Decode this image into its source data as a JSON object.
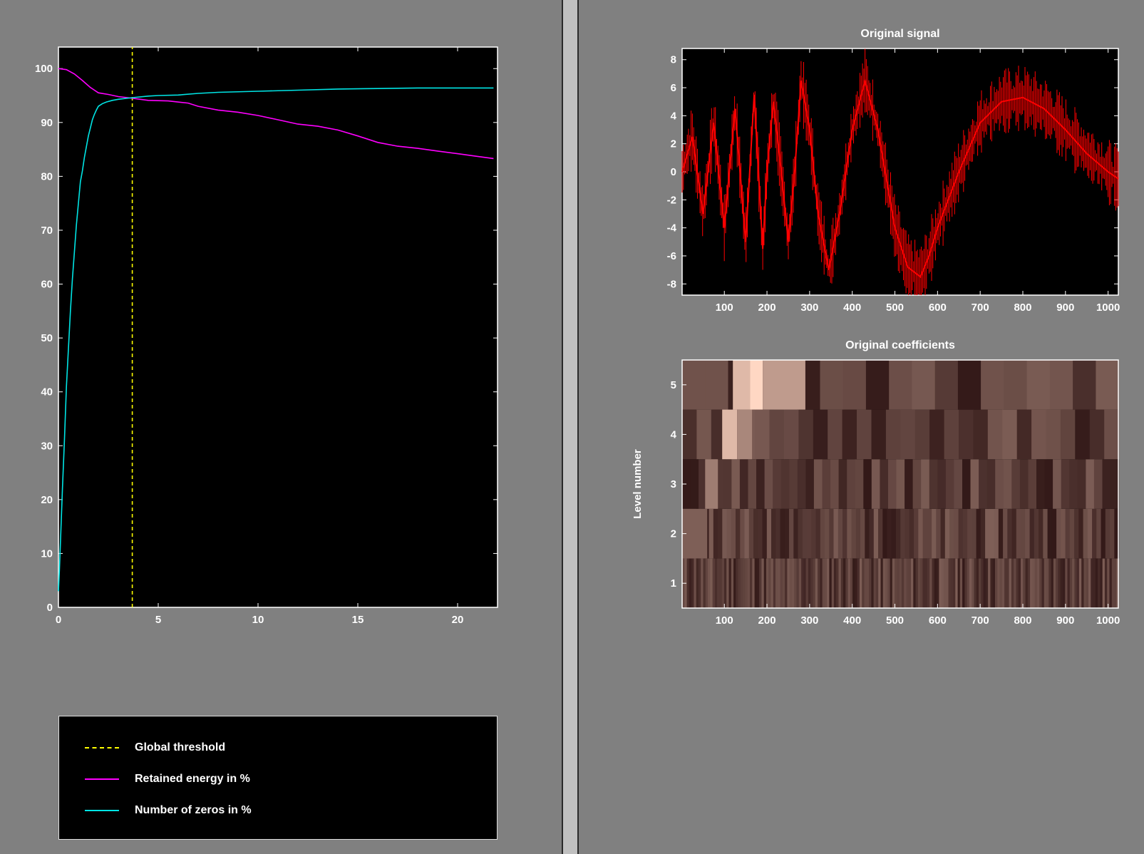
{
  "colors": {
    "background": "#808080",
    "axes_bg": "#000000",
    "threshold": "#ffff00",
    "retained_energy": "#ff00ff",
    "zeros": "#00e5e5",
    "signal": "#ff0000"
  },
  "chart_data": [
    {
      "type": "line",
      "title": "",
      "xlabel": "",
      "ylabel": "",
      "xlim": [
        0,
        22
      ],
      "ylim": [
        0,
        104
      ],
      "xticks": [
        "0",
        "5",
        "10",
        "15",
        "20"
      ],
      "yticks": [
        "0",
        "10",
        "20",
        "30",
        "40",
        "50",
        "60",
        "70",
        "80",
        "90",
        "100"
      ],
      "series": [
        {
          "name": "Global threshold",
          "style": "dashed",
          "x": [
            3.7,
            3.7
          ],
          "values": [
            0,
            104
          ]
        },
        {
          "name": "Retained energy in %",
          "x": [
            0,
            0.4,
            0.8,
            1.2,
            1.6,
            2.0,
            2.5,
            3.0,
            3.7,
            4.5,
            5.5,
            6.5,
            7.0,
            8.0,
            9.0,
            10.0,
            11.0,
            12.0,
            13.0,
            14.0,
            15.0,
            16.0,
            17.0,
            18.0,
            19.0,
            20.0,
            21.0,
            21.8
          ],
          "values": [
            100,
            99.8,
            99.0,
            97.8,
            96.5,
            95.5,
            95.2,
            94.8,
            94.5,
            94.1,
            94.0,
            93.6,
            93.0,
            92.3,
            91.9,
            91.3,
            90.5,
            89.7,
            89.3,
            88.6,
            87.5,
            86.3,
            85.6,
            85.2,
            84.7,
            84.2,
            83.7,
            83.3
          ]
        },
        {
          "name": "Number of zeros in %",
          "x": [
            0,
            0.05,
            0.1,
            0.2,
            0.3,
            0.4,
            0.5,
            0.6,
            0.7,
            0.8,
            0.9,
            1.0,
            1.1,
            1.2,
            1.3,
            1.4,
            1.5,
            1.6,
            1.7,
            1.8,
            1.9,
            2.0,
            2.2,
            2.4,
            2.7,
            3.0,
            3.7,
            4.5,
            5.0,
            6.0,
            7.0,
            8.0,
            10.0,
            12.0,
            14.0,
            16.0,
            18.0,
            20.0,
            21.8
          ],
          "values": [
            3,
            7,
            12,
            22,
            31,
            41,
            48,
            55,
            61,
            66,
            71,
            75,
            79,
            81,
            83.5,
            85.5,
            87.5,
            89,
            90.5,
            91.5,
            92.3,
            93,
            93.5,
            93.8,
            94.1,
            94.3,
            94.6,
            94.9,
            95.0,
            95.1,
            95.4,
            95.6,
            95.8,
            96.0,
            96.2,
            96.3,
            96.4,
            96.4,
            96.4
          ]
        }
      ],
      "legend": "bottom-left panel"
    },
    {
      "type": "line",
      "title": "Original signal",
      "xlabel": "",
      "ylabel": "",
      "xlim": [
        1,
        1024
      ],
      "ylim": [
        -8.8,
        8.8
      ],
      "xticks": [
        "100",
        "200",
        "300",
        "400",
        "500",
        "600",
        "700",
        "800",
        "900",
        "1000"
      ],
      "yticks": [
        "8",
        "6",
        "4",
        "2",
        "0",
        "-2",
        "-4",
        "-6",
        "-8"
      ],
      "series": [
        {
          "name": "",
          "x": [
            1,
            25,
            50,
            75,
            100,
            125,
            150,
            170,
            190,
            200,
            215,
            230,
            250,
            265,
            280,
            300,
            320,
            345,
            370,
            400,
            430,
            460,
            500,
            530,
            560,
            580,
            600,
            650,
            700,
            750,
            800,
            850,
            900,
            950,
            1000,
            1024
          ],
          "values": [
            0,
            2.5,
            -3,
            3.5,
            -4,
            4.5,
            -5,
            5.5,
            -5.5,
            0,
            5,
            1,
            -5,
            0,
            6.5,
            3,
            -3,
            -7,
            -3,
            3,
            6.5,
            3,
            -4,
            -6.8,
            -7.5,
            -6,
            -4,
            0,
            3.5,
            5,
            5.3,
            4.5,
            3,
            1.3,
            0,
            -0.5
          ]
        }
      ]
    },
    {
      "type": "heatmap",
      "title": "Original coefficients",
      "xlabel": "",
      "ylabel": "Level number",
      "xlim": [
        1,
        1024
      ],
      "xticks": [
        "100",
        "200",
        "300",
        "400",
        "500",
        "600",
        "700",
        "800",
        "900",
        "1000"
      ],
      "yticks": [
        "1",
        "2",
        "3",
        "4",
        "5"
      ],
      "levels": [
        1,
        2,
        3,
        4,
        5
      ],
      "peak_regions": [
        {
          "level": 5,
          "x_range": [
            120,
            160
          ],
          "intensity": 0.85
        },
        {
          "level": 5,
          "x_range": [
            160,
            190
          ],
          "intensity": 1.0
        },
        {
          "level": 5,
          "x_range": [
            190,
            290
          ],
          "intensity": 0.7
        },
        {
          "level": 4,
          "x_range": [
            95,
            130
          ],
          "intensity": 0.85
        },
        {
          "level": 4,
          "x_range": [
            130,
            165
          ],
          "intensity": 0.6
        },
        {
          "level": 3,
          "x_range": [
            55,
            85
          ],
          "intensity": 0.55
        },
        {
          "level": 2,
          "x_range": [
            1,
            60
          ],
          "intensity": 0.4
        }
      ]
    }
  ],
  "legend": {
    "items": [
      {
        "label": "Global threshold",
        "color": "#ffff00",
        "style": "dashed"
      },
      {
        "label": "Retained energy in %",
        "color": "#ff00ff",
        "style": "solid"
      },
      {
        "label": "Number of zeros in %",
        "color": "#00e5e5",
        "style": "solid"
      }
    ]
  }
}
